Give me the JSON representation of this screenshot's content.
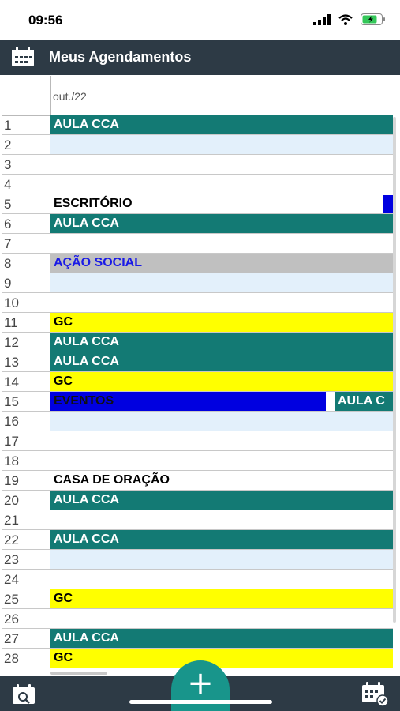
{
  "status_bar": {
    "time": "09:56"
  },
  "header": {
    "title": "Meus Agendamentos"
  },
  "calendar": {
    "month_label": "out./22",
    "rows": [
      {
        "day": "1",
        "event": "AULA CCA"
      },
      {
        "day": "2",
        "event": ""
      },
      {
        "day": "3",
        "event": ""
      },
      {
        "day": "4",
        "event": ""
      },
      {
        "day": "5",
        "event": "ESCRITÓRIO"
      },
      {
        "day": "6",
        "event": "AULA CCA"
      },
      {
        "day": "7",
        "event": ""
      },
      {
        "day": "8",
        "event": "AÇÃO SOCIAL"
      },
      {
        "day": "9",
        "event": ""
      },
      {
        "day": "10",
        "event": ""
      },
      {
        "day": "11",
        "event": "GC"
      },
      {
        "day": "12",
        "event": "AULA CCA"
      },
      {
        "day": "13",
        "event": "AULA CCA"
      },
      {
        "day": "14",
        "event": "GC"
      },
      {
        "day": "15",
        "event": "EVENTOS",
        "event2": "AULA C"
      },
      {
        "day": "16",
        "event": ""
      },
      {
        "day": "17",
        "event": ""
      },
      {
        "day": "18",
        "event": ""
      },
      {
        "day": "19",
        "event": "CASA DE ORAÇÃO"
      },
      {
        "day": "20",
        "event": "AULA CCA"
      },
      {
        "day": "21",
        "event": ""
      },
      {
        "day": "22",
        "event": "AULA CCA"
      },
      {
        "day": "23",
        "event": ""
      },
      {
        "day": "24",
        "event": ""
      },
      {
        "day": "25",
        "event": "GC"
      },
      {
        "day": "26",
        "event": ""
      },
      {
        "day": "27",
        "event": "AULA CCA"
      },
      {
        "day": "28",
        "event": "GC"
      }
    ]
  },
  "fab": {
    "label": "+"
  },
  "colors": {
    "header_bg": "#2d3a45",
    "teal": "#137a74",
    "yellow": "#ffff00",
    "blue": "#0000e0",
    "gray": "#c0c0c0",
    "light_blue": "#e3f0fb",
    "fab": "#18958b"
  }
}
